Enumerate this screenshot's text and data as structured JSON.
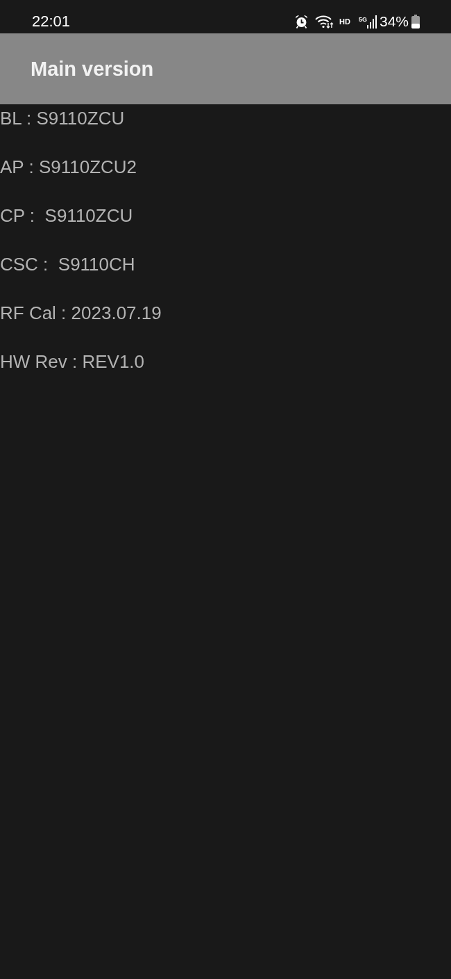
{
  "status_bar": {
    "time": "22:01",
    "hd_label": "HD",
    "network_type": "5G",
    "battery": "34%"
  },
  "header": {
    "title": "Main version"
  },
  "rows": [
    {
      "text": "BL : S9110ZCU"
    },
    {
      "text": "AP : S9110ZCU2"
    },
    {
      "text": "CP :  S9110ZCU"
    },
    {
      "text": "CSC :  S9110CH"
    },
    {
      "text": "RF Cal : 2023.07.19"
    },
    {
      "text": "HW Rev : REV1.0"
    }
  ]
}
